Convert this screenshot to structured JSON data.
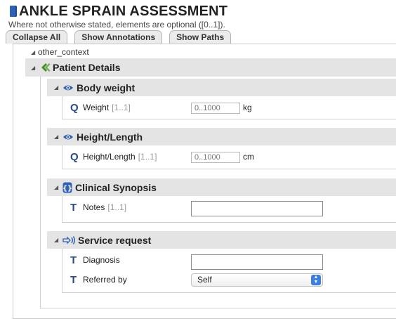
{
  "app": {
    "title": "ANKLE SPRAIN ASSESSMENT",
    "subtitle": "Where not otherwise stated, elements are optional ([0..1])."
  },
  "tabs": [
    {
      "label": "Collapse All"
    },
    {
      "label": "Show Annotations"
    },
    {
      "label": "Show Paths"
    }
  ],
  "tree": {
    "context": {
      "label": "other_context"
    },
    "patient_details": {
      "label": "Patient Details"
    },
    "body_weight": {
      "label": "Body weight",
      "field": {
        "label": "Weight",
        "occurrence": "[1..1]",
        "placeholder": "0..1000",
        "unit": "kg"
      }
    },
    "height_length": {
      "label": "Height/Length",
      "field": {
        "label": "Height/Length",
        "occurrence": "[1..1]",
        "placeholder": "0..1000",
        "unit": "cm"
      }
    },
    "clinical_synopsis": {
      "label": "Clinical Synopsis",
      "field": {
        "label": "Notes",
        "occurrence": "[1..1]"
      }
    },
    "service_request": {
      "label": "Service request",
      "diagnosis": {
        "label": "Diagnosis"
      },
      "referred_by": {
        "label": "Referred by",
        "selected": "Self"
      }
    }
  },
  "colors": {
    "accent_blue": "#2f62b4",
    "header_grey": "#e4e4e4",
    "section_green": "#4a8a2a",
    "select_blue": "#3d7fe0"
  }
}
